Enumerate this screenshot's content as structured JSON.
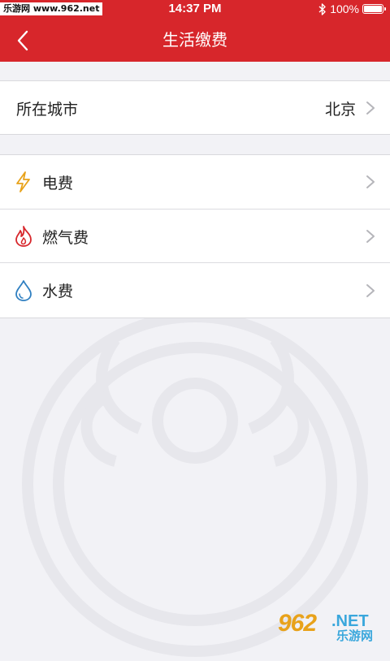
{
  "status_bar": {
    "watermark": "乐游网 www.962.net",
    "time": "14:37 PM",
    "battery": "100%",
    "icons": [
      "bluetooth-icon",
      "battery-icon"
    ]
  },
  "nav": {
    "title": "生活缴费",
    "back_icon": "chevron-left-icon"
  },
  "city": {
    "label": "所在城市",
    "value": "北京"
  },
  "bills": [
    {
      "label": "电费",
      "icon": "lightning-icon",
      "color": "#e8a21a"
    },
    {
      "label": "燃气费",
      "icon": "flame-icon",
      "color": "#d7262b"
    },
    {
      "label": "水费",
      "icon": "water-drop-icon",
      "color": "#2f7fc1"
    }
  ],
  "brand": {
    "number": "962",
    "net": ".NET",
    "sub": "乐游网"
  },
  "colors": {
    "header": "#d7262b",
    "background": "#f2f2f6"
  }
}
